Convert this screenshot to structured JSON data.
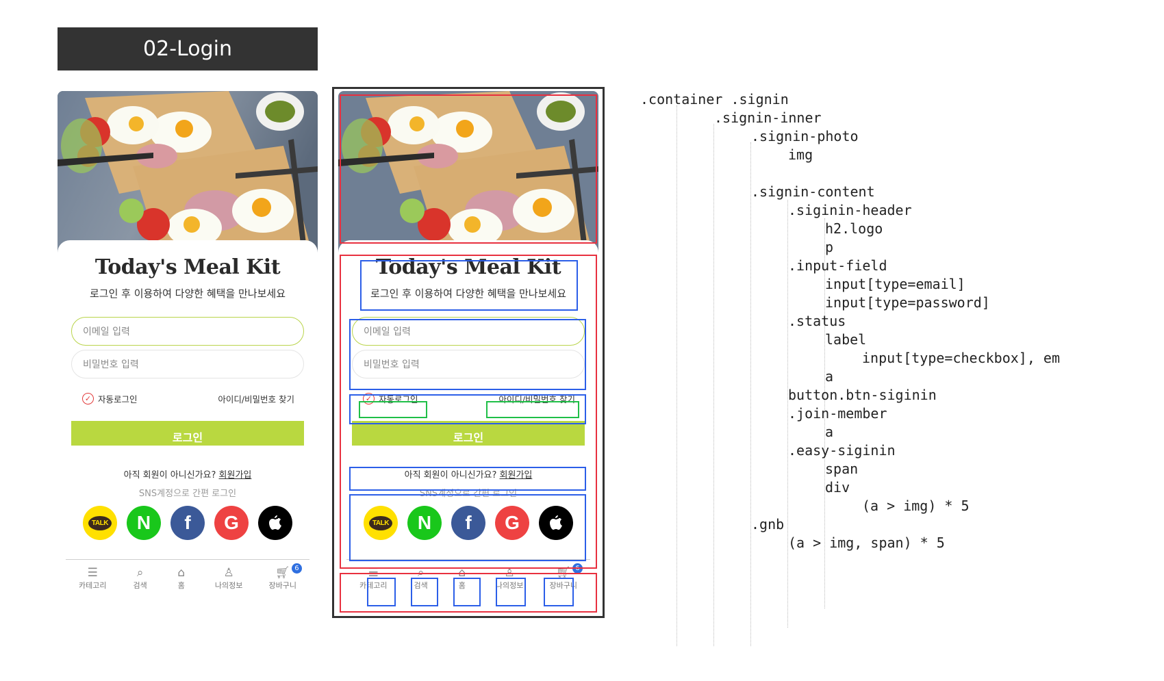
{
  "banner": {
    "title": "02-Login"
  },
  "login": {
    "logo": "Today's Meal Kit",
    "subtitle": "로그인 후 이용하여 다양한 혜택을 만나보세요",
    "email_placeholder": "이메일 입력",
    "password_placeholder": "비밀번호 입력",
    "auto_login": "자동로그인",
    "find_account": "아이디/비밀번호 찾기",
    "login_button": "로그인",
    "join_question": "아직 회원이 아니신가요?",
    "join_link": "회원가입",
    "easy_login": "SNS계정으로 간편 로그인",
    "sns": [
      {
        "name": "kakao",
        "label": "TALK"
      },
      {
        "name": "naver",
        "label": "N"
      },
      {
        "name": "facebook",
        "label": "f"
      },
      {
        "name": "google",
        "label": "G"
      },
      {
        "name": "apple",
        "label": ""
      }
    ]
  },
  "gnb": {
    "items": [
      {
        "label": "카테고리",
        "icon": "menu-icon"
      },
      {
        "label": "검색",
        "icon": "search-icon"
      },
      {
        "label": "홈",
        "icon": "home-icon"
      },
      {
        "label": "나의정보",
        "icon": "user-icon"
      },
      {
        "label": "장바구니",
        "icon": "cart-icon"
      }
    ],
    "cart_badge": "6"
  },
  "colors": {
    "accent_green": "#b9d840",
    "wire_red": "#e8303f",
    "wire_blue": "#2b5ee8",
    "wire_green": "#1fbf47",
    "badge_blue": "#2f6fe0"
  },
  "tree": [
    ".container .signin",
    ".signin-inner",
    ".signin-photo",
    "img",
    ".signin-content",
    ".siginin-header",
    "h2.logo",
    "p",
    ".input-field",
    "input[type=email]",
    "input[type=password]",
    ".status",
    "label",
    "input[type=checkbox], em",
    "a",
    "button.btn-siginin",
    ".join-member",
    "a",
    ".easy-siginin",
    "span",
    "div",
    "(a > img) * 5",
    ".gnb",
    "(a > img, span) * 5"
  ]
}
